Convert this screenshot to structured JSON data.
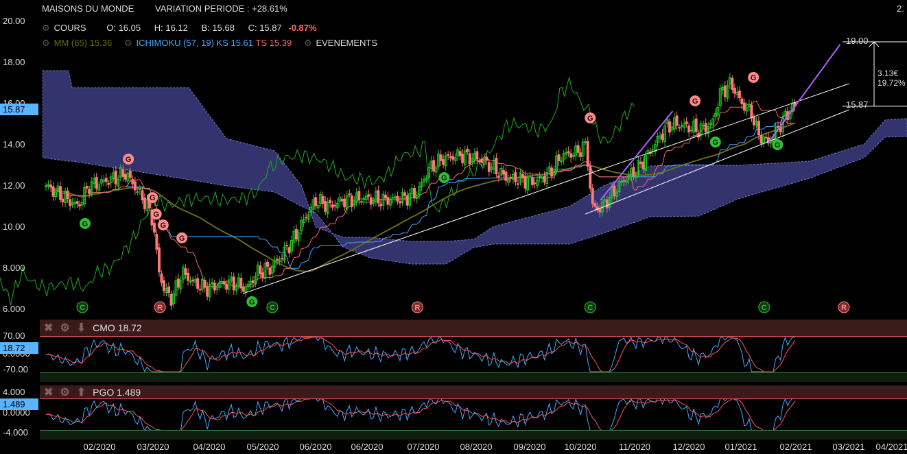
{
  "header": {
    "name": "MAISONS DU MONDE",
    "variation": "VARIATION PERIODE : +28.61%",
    "corner": "2."
  },
  "cours": {
    "label": "COURS",
    "o": "O: 16.05",
    "h": "H: 16.12",
    "b": "B: 15.68",
    "c": "C: 15.87",
    "chg": "-0.87%"
  },
  "indicators": {
    "mm": "MM (65) 15.36",
    "ichimoku": "ICHIMOKU (57, 19)",
    "ks": "KS 15.61",
    "ts": "TS 15.39",
    "events": "EVENEMENTS"
  },
  "colors": {
    "up": "#22cc22",
    "down": "#ff7777",
    "cloud": "#33336e",
    "mm": "#6b6b10",
    "ks": "#4aa8ff",
    "ts": "#ff6666",
    "chikou": "#22aa22",
    "trend": "#ffffff",
    "channel": "#b060ff"
  },
  "cmo": {
    "label": "CMO 18.72",
    "value": "18.72",
    "axis": [
      "70.00",
      "0.0000",
      "-70.00"
    ]
  },
  "pgo": {
    "label": "PGO 1.489",
    "value": "1.489",
    "axis": [
      "4.000",
      "0.0000",
      "-4.000"
    ]
  },
  "target": {
    "high": "19.00",
    "low": "15.87",
    "diff": "3.13€",
    "pct": "19.72%"
  },
  "chart_data": {
    "type": "candlestick",
    "title": "MAISONS DU MONDE",
    "yticks": [
      "20.00",
      "18.00",
      "16.00",
      "14.00",
      "12.00",
      "10.00",
      "8.000",
      "6.000"
    ],
    "ylim": [
      6,
      20
    ],
    "current_price": "15.87",
    "xticks": [
      "02/2020",
      "03/2020",
      "04/2020",
      "05/2020",
      "06/2020",
      "06/2020",
      "07/2020",
      "08/2020",
      "09/2020",
      "10/2020",
      "11/2020",
      "12/2020",
      "01/2021",
      "02/2021",
      "03/2021",
      "04/2021"
    ],
    "x_unit": "months since 01/2020",
    "close_path": [
      [
        0,
        12.0
      ],
      [
        0.3,
        11.5
      ],
      [
        0.6,
        11.0
      ],
      [
        0.8,
        12.0
      ],
      [
        1.2,
        12.3
      ],
      [
        1.5,
        12.6
      ],
      [
        1.7,
        11.8
      ],
      [
        1.9,
        11.0
      ],
      [
        2.0,
        10.3
      ],
      [
        2.1,
        8.0
      ],
      [
        2.2,
        7.0
      ],
      [
        2.35,
        6.5
      ],
      [
        2.55,
        7.8
      ],
      [
        2.75,
        7.3
      ],
      [
        3.0,
        7.0
      ],
      [
        3.25,
        7.2
      ],
      [
        3.5,
        7.3
      ],
      [
        3.75,
        7.0
      ],
      [
        3.95,
        7.8
      ],
      [
        4.2,
        8.0
      ],
      [
        4.4,
        8.6
      ],
      [
        4.65,
        9.5
      ],
      [
        4.85,
        10.5
      ],
      [
        5.05,
        11.3
      ],
      [
        5.3,
        11.0
      ],
      [
        5.55,
        11.3
      ],
      [
        5.95,
        11.4
      ],
      [
        6.3,
        11.3
      ],
      [
        6.7,
        11.4
      ],
      [
        6.95,
        11.7
      ],
      [
        7.15,
        12.8
      ],
      [
        7.4,
        13.3
      ],
      [
        7.75,
        13.5
      ],
      [
        8.1,
        13.3
      ],
      [
        8.35,
        12.9
      ],
      [
        8.6,
        12.4
      ],
      [
        8.9,
        12.3
      ],
      [
        9.15,
        12.2
      ],
      [
        9.4,
        12.6
      ],
      [
        9.65,
        13.5
      ],
      [
        9.9,
        13.6
      ],
      [
        10.1,
        14.0
      ],
      [
        10.2,
        11.0
      ],
      [
        10.35,
        10.9
      ],
      [
        10.55,
        11.5
      ],
      [
        10.8,
        12.3
      ],
      [
        11.05,
        12.8
      ],
      [
        11.3,
        13.7
      ],
      [
        11.6,
        14.9
      ],
      [
        11.75,
        15.0
      ],
      [
        11.95,
        14.9
      ],
      [
        12.2,
        14.7
      ],
      [
        12.45,
        15.0
      ],
      [
        12.6,
        16.5
      ],
      [
        12.8,
        17.0
      ],
      [
        13.0,
        16.0
      ],
      [
        13.2,
        15.5
      ],
      [
        13.3,
        14.5
      ],
      [
        13.5,
        14.1
      ],
      [
        13.7,
        14.9
      ],
      [
        13.9,
        15.7
      ],
      [
        14.0,
        15.87
      ]
    ],
    "cloud": [
      [
        -0.06,
        17.6,
        13.37
      ],
      [
        0.42,
        17.6,
        13.2
      ],
      [
        0.49,
        16.77,
        13.2
      ],
      [
        2.67,
        16.77,
        12.3
      ],
      [
        3.37,
        14.3,
        12.0
      ],
      [
        4.27,
        13.7,
        11.7
      ],
      [
        4.78,
        12.0,
        11.0
      ],
      [
        5.04,
        10.0,
        10.7
      ],
      [
        5.55,
        9.5,
        9.03
      ],
      [
        6.06,
        9.5,
        8.5
      ],
      [
        6.83,
        9.3,
        8.2
      ],
      [
        7.47,
        9.3,
        8.2
      ],
      [
        7.99,
        9.4,
        9.0
      ],
      [
        8.37,
        10.03,
        9.17
      ],
      [
        9.78,
        11.0,
        9.17
      ],
      [
        10.42,
        12.0,
        9.7
      ],
      [
        11.3,
        12.97,
        10.5
      ],
      [
        12.2,
        13.0,
        10.53
      ],
      [
        12.94,
        13.0,
        11.37
      ],
      [
        14.27,
        13.2,
        12.37
      ],
      [
        15.29,
        14.03,
        13.37
      ],
      [
        15.68,
        15.2,
        14.37
      ],
      [
        16.09,
        15.27,
        14.4
      ]
    ],
    "events": [
      {
        "t": 1.54,
        "p": 13.3,
        "l": "G",
        "k": "sell"
      },
      {
        "t": 1.99,
        "p": 11.43,
        "l": "G",
        "k": "sell"
      },
      {
        "t": 2.06,
        "p": 10.63,
        "l": "G",
        "k": "sell"
      },
      {
        "t": 2.19,
        "p": 10.1,
        "l": "G",
        "k": "sell"
      },
      {
        "t": 2.54,
        "p": 9.47,
        "l": "G",
        "k": "sell"
      },
      {
        "t": 10.17,
        "p": 15.3,
        "l": "G",
        "k": "sell"
      },
      {
        "t": 12.13,
        "p": 16.13,
        "l": "G",
        "k": "sell"
      },
      {
        "t": 13.22,
        "p": 17.27,
        "l": "G",
        "k": "sell"
      },
      {
        "t": 0.73,
        "p": 10.17,
        "l": "G",
        "k": "buy"
      },
      {
        "t": 3.85,
        "p": 6.37,
        "l": "G",
        "k": "buy"
      },
      {
        "t": 7.44,
        "p": 12.4,
        "l": "G",
        "k": "buy"
      },
      {
        "t": 12.51,
        "p": 14.13,
        "l": "G",
        "k": "buy"
      },
      {
        "t": 13.67,
        "p": 14.0,
        "l": "G",
        "k": "buy"
      },
      {
        "t": 0.68,
        "p": 6.1,
        "l": "C",
        "k": "cbuy"
      },
      {
        "t": 2.13,
        "p": 6.1,
        "l": "R",
        "k": "csell"
      },
      {
        "t": 4.23,
        "p": 6.1,
        "l": "C",
        "k": "cbuy"
      },
      {
        "t": 6.94,
        "p": 6.1,
        "l": "R",
        "k": "csell"
      },
      {
        "t": 10.17,
        "p": 6.1,
        "l": "C",
        "k": "cbuy"
      },
      {
        "t": 13.42,
        "p": 6.1,
        "l": "C",
        "k": "cbuy"
      },
      {
        "t": 14.91,
        "p": 6.1,
        "l": "R",
        "k": "csell"
      }
    ],
    "trendlines": [
      [
        [
          3.69,
          6.77
        ],
        [
          15.01,
          16.97
        ]
      ],
      [
        [
          10.08,
          10.63
        ],
        [
          15.01,
          15.7
        ]
      ]
    ],
    "channel": [
      [
        [
          10.36,
          11.3
        ],
        [
          11.71,
          15.63
        ]
      ],
      [
        [
          13.5,
          14.1
        ],
        [
          14.84,
          18.87
        ]
      ]
    ]
  }
}
